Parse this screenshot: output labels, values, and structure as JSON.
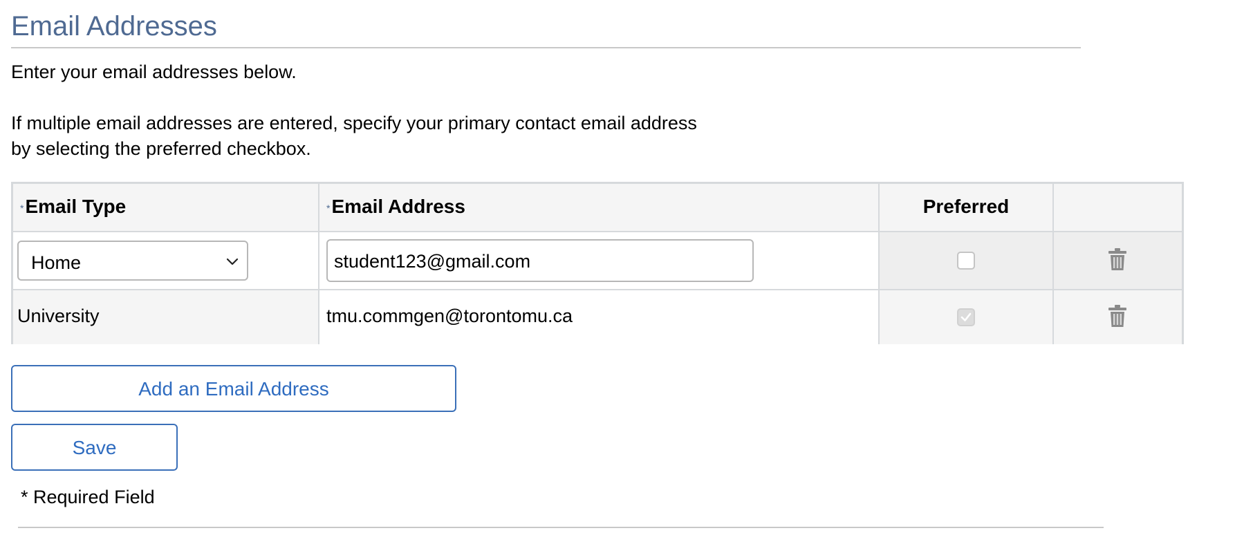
{
  "page": {
    "title": "Email Addresses",
    "intro": "Enter your email addresses below.",
    "instructions": "If multiple email addresses are entered, specify your primary contact email address by selecting the preferred checkbox."
  },
  "grid": {
    "columns": {
      "required_mark": "*",
      "email_type": "Email Type",
      "email_address": "Email Address",
      "preferred": "Preferred"
    },
    "rows": [
      {
        "email_type": "Home",
        "email_address": "student123@gmail.com",
        "preferred": false,
        "editable": true
      },
      {
        "email_type": "University",
        "email_address": "tmu.commgen@torontomu.ca",
        "preferred": true,
        "editable": false
      }
    ]
  },
  "actions": {
    "add_label": "Add an Email Address",
    "save_label": "Save"
  },
  "footer": {
    "required_note": "* Required Field"
  },
  "colors": {
    "title": "#4f6a92",
    "button_text": "#2f6cc0",
    "button_border": "#3a6fb8",
    "grid_border": "#d6d9dc"
  },
  "icons": {
    "delete": "trash-icon",
    "dropdown": "chevron-down-icon",
    "checked": "checkmark-icon"
  }
}
